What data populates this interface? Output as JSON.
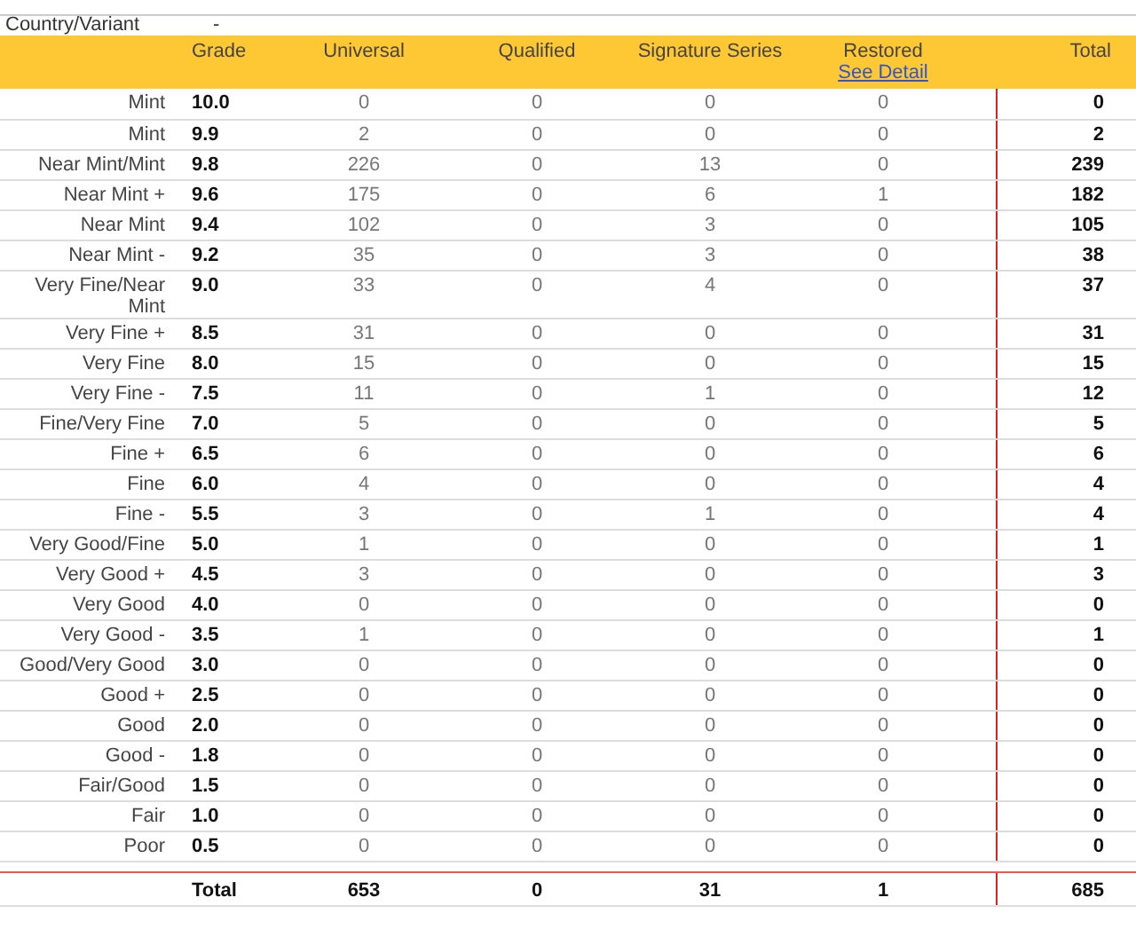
{
  "info_rows": [
    {
      "label": "Country/Variant",
      "value": "-"
    }
  ],
  "table": {
    "columns": [
      {
        "label": "Grade"
      },
      {
        "label": "Universal"
      },
      {
        "label": "Qualified"
      },
      {
        "label": "Signature Series"
      },
      {
        "label": "Restored",
        "link": "See Detail"
      },
      {
        "label": "Total"
      }
    ],
    "rows": [
      {
        "name": "Mint",
        "grade": "10.0",
        "universal": "0",
        "qualified": "0",
        "signature": "0",
        "restored": "0",
        "total": "0"
      },
      {
        "name": "Mint",
        "grade": "9.9",
        "universal": "2",
        "qualified": "0",
        "signature": "0",
        "restored": "0",
        "total": "2"
      },
      {
        "name": "Near Mint/Mint",
        "grade": "9.8",
        "universal": "226",
        "qualified": "0",
        "signature": "13",
        "restored": "0",
        "total": "239"
      },
      {
        "name": "Near Mint +",
        "grade": "9.6",
        "universal": "175",
        "qualified": "0",
        "signature": "6",
        "restored": "1",
        "total": "182"
      },
      {
        "name": "Near Mint",
        "grade": "9.4",
        "universal": "102",
        "qualified": "0",
        "signature": "3",
        "restored": "0",
        "total": "105"
      },
      {
        "name": "Near Mint -",
        "grade": "9.2",
        "universal": "35",
        "qualified": "0",
        "signature": "3",
        "restored": "0",
        "total": "38"
      },
      {
        "name": "Very Fine/Near Mint",
        "grade": "9.0",
        "universal": "33",
        "qualified": "0",
        "signature": "4",
        "restored": "0",
        "total": "37"
      },
      {
        "name": "Very Fine +",
        "grade": "8.5",
        "universal": "31",
        "qualified": "0",
        "signature": "0",
        "restored": "0",
        "total": "31"
      },
      {
        "name": "Very Fine",
        "grade": "8.0",
        "universal": "15",
        "qualified": "0",
        "signature": "0",
        "restored": "0",
        "total": "15"
      },
      {
        "name": "Very Fine -",
        "grade": "7.5",
        "universal": "11",
        "qualified": "0",
        "signature": "1",
        "restored": "0",
        "total": "12"
      },
      {
        "name": "Fine/Very Fine",
        "grade": "7.0",
        "universal": "5",
        "qualified": "0",
        "signature": "0",
        "restored": "0",
        "total": "5"
      },
      {
        "name": "Fine +",
        "grade": "6.5",
        "universal": "6",
        "qualified": "0",
        "signature": "0",
        "restored": "0",
        "total": "6"
      },
      {
        "name": "Fine",
        "grade": "6.0",
        "universal": "4",
        "qualified": "0",
        "signature": "0",
        "restored": "0",
        "total": "4"
      },
      {
        "name": "Fine -",
        "grade": "5.5",
        "universal": "3",
        "qualified": "0",
        "signature": "1",
        "restored": "0",
        "total": "4"
      },
      {
        "name": "Very Good/Fine",
        "grade": "5.0",
        "universal": "1",
        "qualified": "0",
        "signature": "0",
        "restored": "0",
        "total": "1"
      },
      {
        "name": "Very Good +",
        "grade": "4.5",
        "universal": "3",
        "qualified": "0",
        "signature": "0",
        "restored": "0",
        "total": "3"
      },
      {
        "name": "Very Good",
        "grade": "4.0",
        "universal": "0",
        "qualified": "0",
        "signature": "0",
        "restored": "0",
        "total": "0"
      },
      {
        "name": "Very Good -",
        "grade": "3.5",
        "universal": "1",
        "qualified": "0",
        "signature": "0",
        "restored": "0",
        "total": "1"
      },
      {
        "name": "Good/Very Good",
        "grade": "3.0",
        "universal": "0",
        "qualified": "0",
        "signature": "0",
        "restored": "0",
        "total": "0"
      },
      {
        "name": "Good +",
        "grade": "2.5",
        "universal": "0",
        "qualified": "0",
        "signature": "0",
        "restored": "0",
        "total": "0"
      },
      {
        "name": "Good",
        "grade": "2.0",
        "universal": "0",
        "qualified": "0",
        "signature": "0",
        "restored": "0",
        "total": "0"
      },
      {
        "name": "Good -",
        "grade": "1.8",
        "universal": "0",
        "qualified": "0",
        "signature": "0",
        "restored": "0",
        "total": "0"
      },
      {
        "name": "Fair/Good",
        "grade": "1.5",
        "universal": "0",
        "qualified": "0",
        "signature": "0",
        "restored": "0",
        "total": "0"
      },
      {
        "name": "Fair",
        "grade": "1.0",
        "universal": "0",
        "qualified": "0",
        "signature": "0",
        "restored": "0",
        "total": "0"
      },
      {
        "name": "Poor",
        "grade": "0.5",
        "universal": "0",
        "qualified": "0",
        "signature": "0",
        "restored": "0",
        "total": "0"
      }
    ],
    "totals": {
      "label": "Total",
      "universal": "653",
      "qualified": "0",
      "signature": "31",
      "restored": "1",
      "total": "685"
    }
  }
}
